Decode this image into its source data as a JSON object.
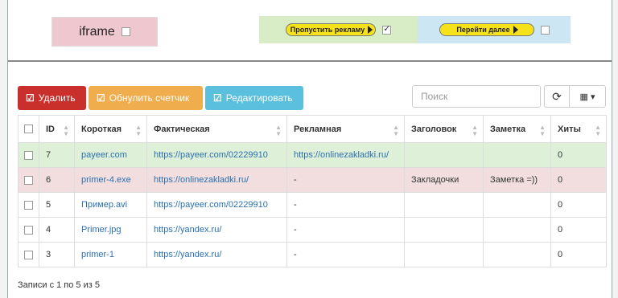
{
  "top": {
    "iframe_label": "iframe",
    "skip_ad_label": "Пропустить рекламу",
    "next_label": "Перейти далее"
  },
  "toolbar": {
    "delete_label": "Удалить",
    "reset_label": "Обнулить счетчик",
    "edit_label": "Редактировать",
    "search_placeholder": "Поиск",
    "refresh_icon": "refresh-icon",
    "columns_icon": "grid-icon"
  },
  "colors": {
    "delete": "#c9302c",
    "reset": "#f0ad4e",
    "edit": "#5bc0de",
    "row_success": "#dff0d8",
    "row_danger": "#f2dede"
  },
  "table": {
    "headers": [
      "ID",
      "Короткая",
      "Фактическая",
      "Рекламная",
      "Заголовок",
      "Заметка",
      "Хиты"
    ],
    "rows": [
      {
        "id": "7",
        "short": "payeer.com",
        "actual": "https://payeer.com/02229910",
        "ad": "https://onlinezakladki.ru/",
        "title": "",
        "note": "",
        "hits": "0",
        "state": "success"
      },
      {
        "id": "6",
        "short": "primer-4.exe",
        "actual": "https://onlinezakladki.ru/",
        "ad": "-",
        "title": "Закладочки",
        "note": "Заметка =))",
        "hits": "0",
        "state": "danger"
      },
      {
        "id": "5",
        "short": "Пример.avi",
        "actual": "https://payeer.com/02229910",
        "ad": "-",
        "title": "",
        "note": "",
        "hits": "0",
        "state": ""
      },
      {
        "id": "4",
        "short": "Primer.jpg",
        "actual": "https://yandex.ru/",
        "ad": "-",
        "title": "",
        "note": "",
        "hits": "0",
        "state": ""
      },
      {
        "id": "3",
        "short": "primer-1",
        "actual": "https://yandex.ru/",
        "ad": "-",
        "title": "",
        "note": "",
        "hits": "0",
        "state": ""
      }
    ]
  },
  "footer": {
    "records_text": "Записи с 1 по 5 из 5"
  }
}
